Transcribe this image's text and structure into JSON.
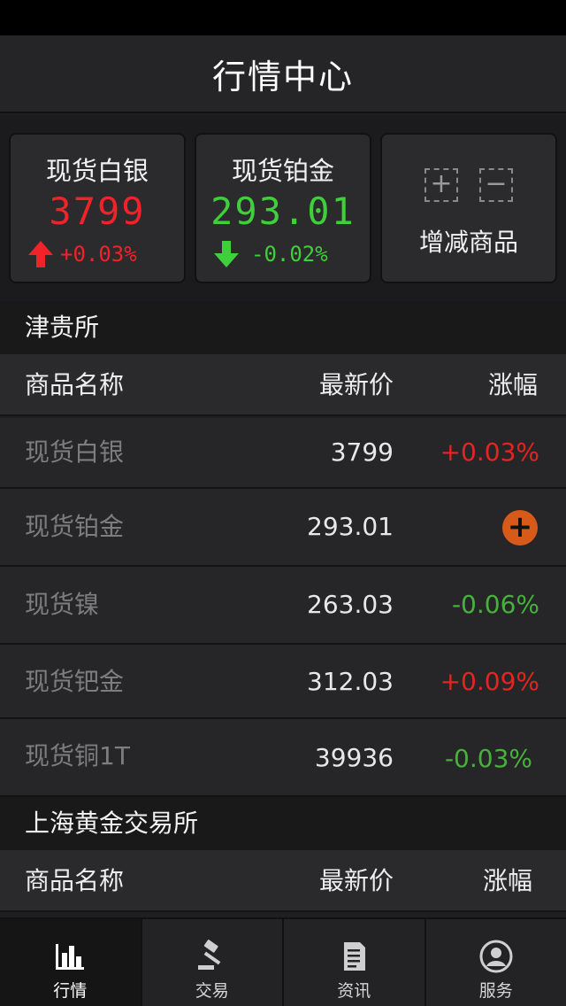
{
  "header": {
    "title": "行情中心"
  },
  "cards": [
    {
      "name": "现货白银",
      "price": "3799",
      "change": "+0.03%",
      "direction": "up",
      "color": "#f0222a"
    },
    {
      "name": "现货铂金",
      "price": "293.01",
      "change": "-0.02%",
      "direction": "down",
      "color": "#3fcf3a"
    }
  ],
  "edit_card": {
    "plus": "+",
    "minus": "−",
    "label": "增减商品"
  },
  "sections": [
    {
      "title": "津贵所",
      "columns": {
        "name": "商品名称",
        "price": "最新价",
        "change": "涨幅"
      },
      "rows": [
        {
          "name": "现货白银",
          "price": "3799",
          "change": "+0.03%",
          "color": "#e1261f"
        },
        {
          "name": "现货铂金",
          "price": "293.01",
          "change": "",
          "action_icon": "plus-circle-icon"
        },
        {
          "name": "现货镍",
          "price": "263.03",
          "change": "-0.06%",
          "color": "#46b23c"
        },
        {
          "name": "现货钯金",
          "price": "312.03",
          "change": "+0.09%",
          "color": "#e1261f"
        },
        {
          "name": "现货铜1T",
          "price": "39936",
          "change": "-0.03%",
          "color": "#46b23c"
        }
      ]
    },
    {
      "title": "上海黄金交易所",
      "columns": {
        "name": "商品名称",
        "price": "最新价",
        "change": "涨幅"
      }
    }
  ],
  "tabs": [
    {
      "label": "行情",
      "icon": "bar-chart-icon",
      "active": true
    },
    {
      "label": "交易",
      "icon": "gavel-icon",
      "active": false
    },
    {
      "label": "资讯",
      "icon": "document-icon",
      "active": false
    },
    {
      "label": "服务",
      "icon": "user-icon",
      "active": false
    }
  ]
}
